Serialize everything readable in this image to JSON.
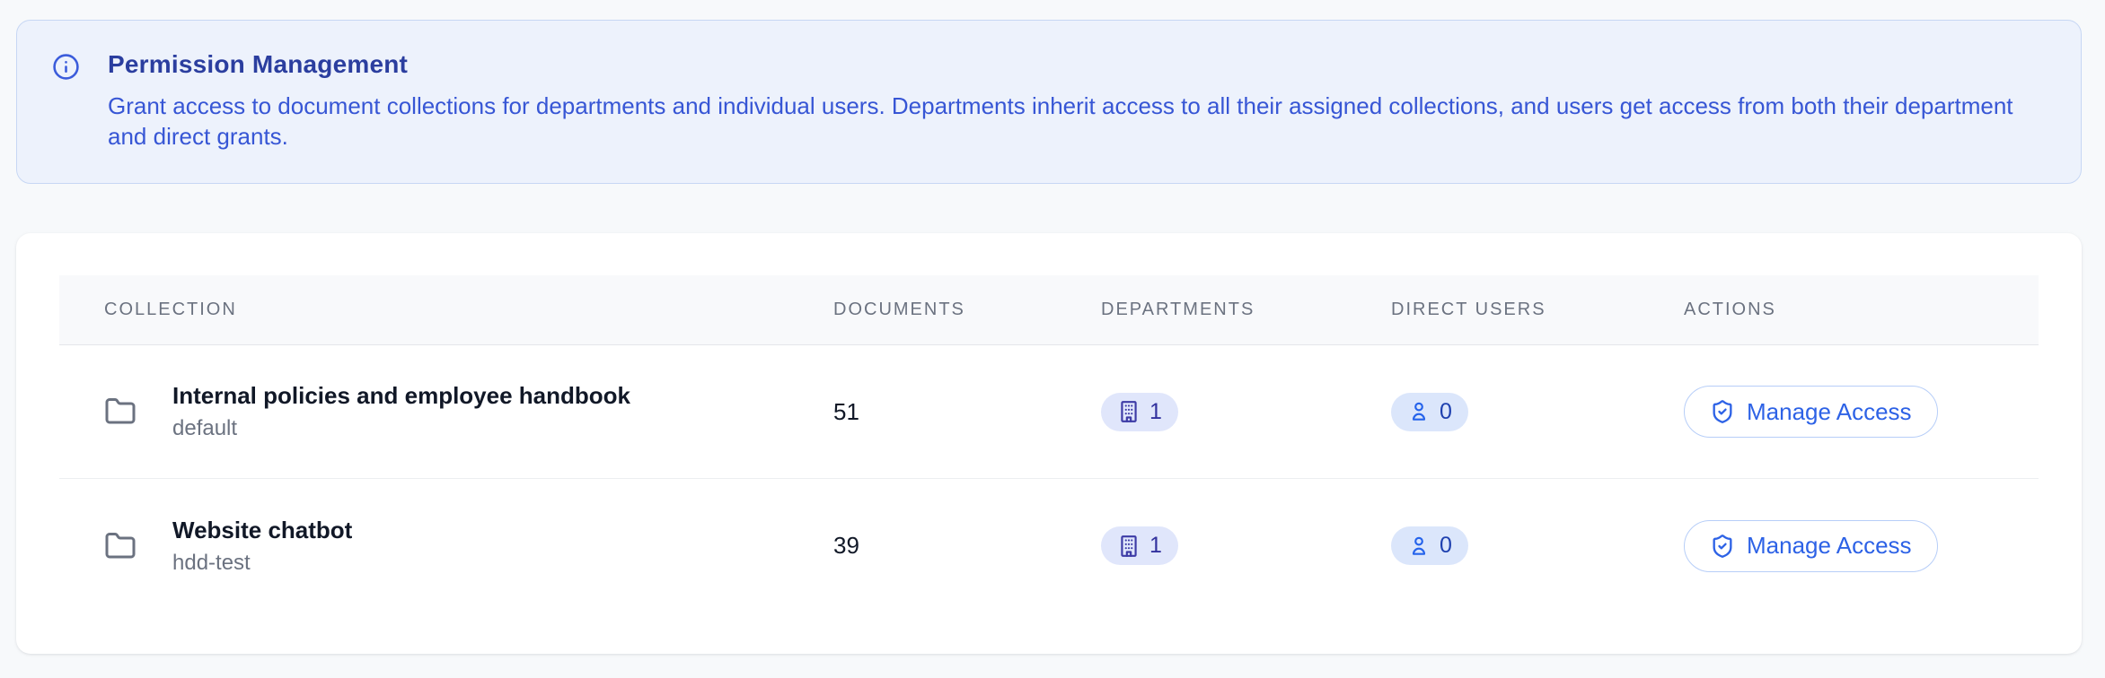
{
  "banner": {
    "icon": "info-icon",
    "title": "Permission Management",
    "description": "Grant access to document collections for departments and individual users. Departments inherit access to all their assigned collections, and users get access from both their department and direct grants."
  },
  "table": {
    "columns": {
      "collection": "COLLECTION",
      "documents": "DOCUMENTS",
      "departments": "DEPARTMENTS",
      "direct_users": "DIRECT USERS",
      "actions": "ACTIONS"
    },
    "rows": [
      {
        "icon": "folder-icon",
        "name": "Internal policies and employee handbook",
        "slug": "default",
        "documents": "51",
        "departments": "1",
        "direct_users": "0",
        "action_label": "Manage Access"
      },
      {
        "icon": "folder-icon",
        "name": "Website chatbot",
        "slug": "hdd-test",
        "documents": "39",
        "departments": "1",
        "direct_users": "0",
        "action_label": "Manage Access"
      }
    ]
  },
  "colors": {
    "page_bg": "#f7f9fb",
    "banner_bg": "#edf2fc",
    "banner_border": "#c7d7f4",
    "banner_title": "#2b3e9f",
    "banner_text": "#3756d5",
    "department_badge_bg": "#e0e6fb",
    "department_badge_fg": "#32319e",
    "user_badge_bg": "#dbe6fb",
    "user_badge_fg": "#1e40af",
    "button_fg": "#2d62e6",
    "button_border": "#b7cef8"
  }
}
